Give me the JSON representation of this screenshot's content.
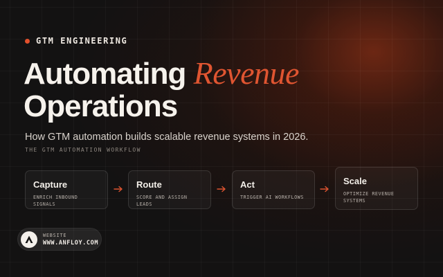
{
  "eyebrow": {
    "label": "GTM ENGINEERING"
  },
  "headline": {
    "line1_prefix": "Automating",
    "line1_accent": "Revenue",
    "line2": "Operations"
  },
  "subtitle": "How GTM automation builds scalable revenue systems in 2026.",
  "workflow": {
    "label": "THE GTM AUTOMATION WORKFLOW",
    "steps": [
      {
        "title": "Capture",
        "desc": "ENRICH INBOUND SIGNALS"
      },
      {
        "title": "Route",
        "desc": "SCORE AND ASSIGN LEADS"
      },
      {
        "title": "Act",
        "desc": "TRIGGER AI WORKFLOWS"
      },
      {
        "title": "Scale",
        "desc_line1": "OPTIMIZE REVENUE",
        "desc_line2": "SYSTEMS"
      }
    ]
  },
  "website": {
    "label": "WEBSITE",
    "url": "WWW.ANFLOY.COM"
  },
  "icons": {
    "bullet": "dot-icon",
    "arrow": "arrow-right-icon",
    "logo": "anfloy-logo-icon"
  },
  "colors": {
    "accent": "#e05531",
    "background": "#131212",
    "text": "#f3efe9"
  }
}
